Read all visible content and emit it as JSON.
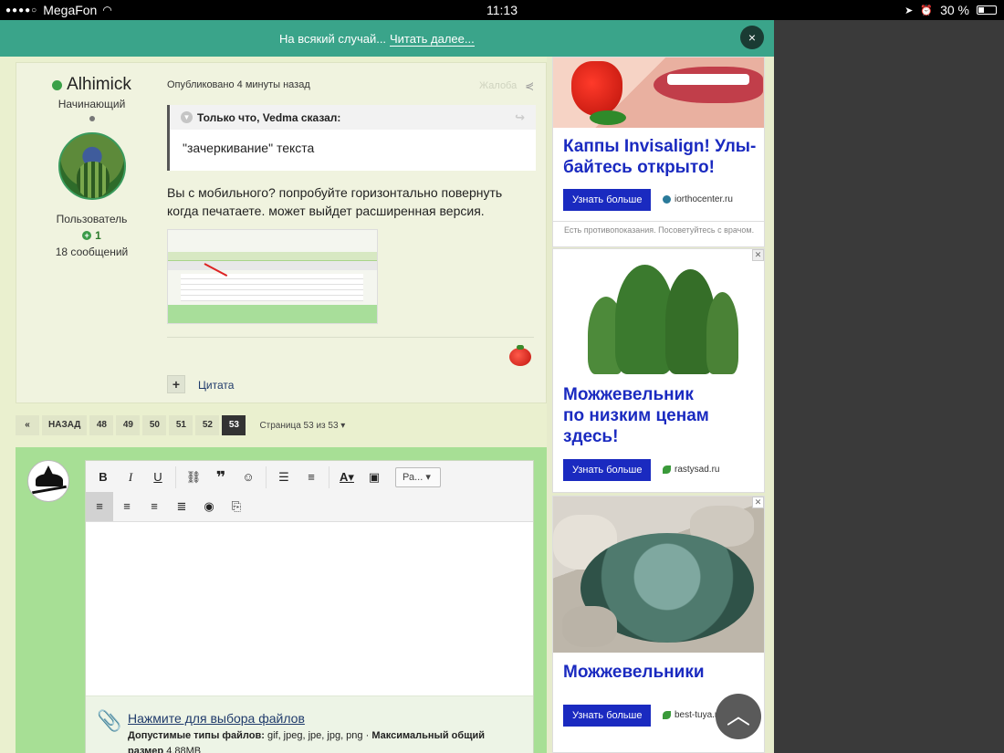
{
  "status_bar": {
    "carrier": "MegaFon",
    "time": "11:13",
    "battery": "30 %"
  },
  "banner": {
    "text": "На всякий случай...",
    "link": "Читать далее...",
    "close": "×"
  },
  "post": {
    "author": "Alhimick",
    "rank": "Начинающий",
    "group": "Пользователь",
    "reputation": "1",
    "post_count": "18 сообщений",
    "published": "Опубликовано 4 минуты назад",
    "report": "Жалоба",
    "quote_header": "Только что, Vedma сказал:",
    "quote_body": "\"зачеркивание\" текста",
    "body": "Вы с мобильного? попробуйте горизонтально повернуть когда печатаете. может выйдет расширенная версия.",
    "quote_button": "Цитата"
  },
  "pagination": {
    "first": "«",
    "prev": "НАЗАД",
    "pages": [
      "48",
      "49",
      "50",
      "51",
      "52",
      "53"
    ],
    "active_page": "53",
    "info": "Страница 53 из 53"
  },
  "editor": {
    "font_select": "Ра...",
    "attach_link": "Нажмите для выбора файлов",
    "allowed_label": "Допустимые типы файлов:",
    "allowed_types": "gif, jpeg, jpe, jpg, png",
    "max_label": "Максимальный общий размер",
    "max_size": "4.88MB"
  },
  "ads": [
    {
      "title_line1": "Каппы Invisalign! Улы-",
      "title_line2": "байтесь открыто!",
      "button": "Узнать больше",
      "domain": "iorthocenter.ru",
      "disclaimer": "Есть противопоказания. Посоветуйтесь с врачом."
    },
    {
      "title_line1": "Можжевельник",
      "title_line2": "по низким ценам",
      "title_line3": "здесь!",
      "button": "Узнать больше",
      "domain": "rastysad.ru"
    },
    {
      "title_line1": "Можжевельники",
      "button": "Узнать больше",
      "domain": "best-tuya.ru"
    }
  ],
  "colors": {
    "banner": "#3aa48a",
    "page_bg": "#eaf0cf",
    "reply_bg": "#a7df95",
    "ad_blue": "#1a2ac0"
  }
}
